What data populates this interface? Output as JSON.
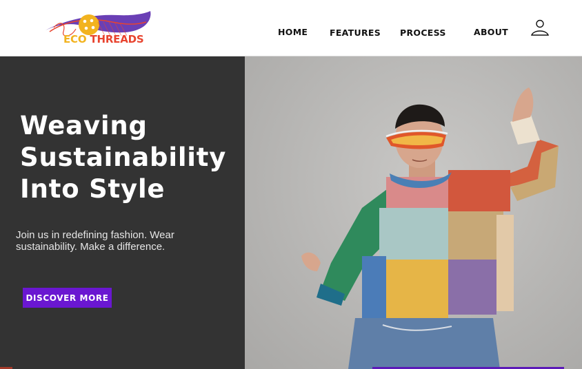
{
  "brand": {
    "logo_eco": "ECO",
    "logo_threads": " THREADS",
    "colors": {
      "eco": "#f2b31f",
      "threads": "#e8442f",
      "swoosh": "#6a3fb5"
    }
  },
  "nav": {
    "home": "HOME",
    "features": "FEATURES",
    "process": "PROCESS",
    "about": "ABOUT",
    "user_icon": "user-icon"
  },
  "hero": {
    "title_line1": "Weaving",
    "title_line2": "Sustainability",
    "title_line3": "Into Style",
    "subtitle": "Join us in redefining fashion. Wear sustainability. Make a difference.",
    "cta_label": "DISCOVER  MORE",
    "accent_color": "#6a17d1",
    "panel_color": "#333333"
  }
}
